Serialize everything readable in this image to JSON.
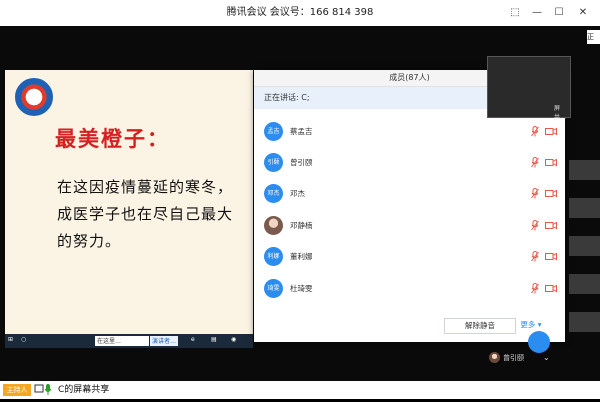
{
  "window": {
    "title": "腾讯会议 会议号：166 814 398",
    "minimize": "—",
    "restore": "☐",
    "close": "✕",
    "pin": "⬚"
  },
  "slide": {
    "title": "最美橙子：",
    "body": "在这因疫情蔓延的寒冬，成医学子也在尽自己最大的努力。",
    "taskbar_search": "在这里…",
    "taskbar_pill": "演讲者…"
  },
  "members_panel": {
    "title": "成员(87人)",
    "speaking": "正在讲话: C;",
    "members": [
      {
        "avatar": "孟吉",
        "name": "蔡孟吉"
      },
      {
        "avatar": "引颐",
        "name": "曾引颐"
      },
      {
        "avatar": "邓杰",
        "name": "邓杰"
      },
      {
        "avatar": "",
        "name": "邓静楠"
      },
      {
        "avatar": "利娜",
        "name": "董利娜"
      },
      {
        "avatar": "琦雯",
        "name": "杜琦雯"
      }
    ],
    "unmute_all_label": "解除静音",
    "more_label": "更多 ▾",
    "min_btn": "—",
    "max_btn": "☐",
    "close_btn": "✕"
  },
  "side": {
    "share_label": "正",
    "thumb_text": "屏共…",
    "bottom_user": "曾引颐",
    "chevron": "⌄"
  },
  "status": {
    "host_badge": "主持人",
    "share_text": "C的屏幕共享"
  },
  "colors": {
    "accent": "#2b8df0",
    "slide_title": "#d71f1f",
    "host_badge": "#f5a623",
    "muted_icon": "#e8574a"
  }
}
